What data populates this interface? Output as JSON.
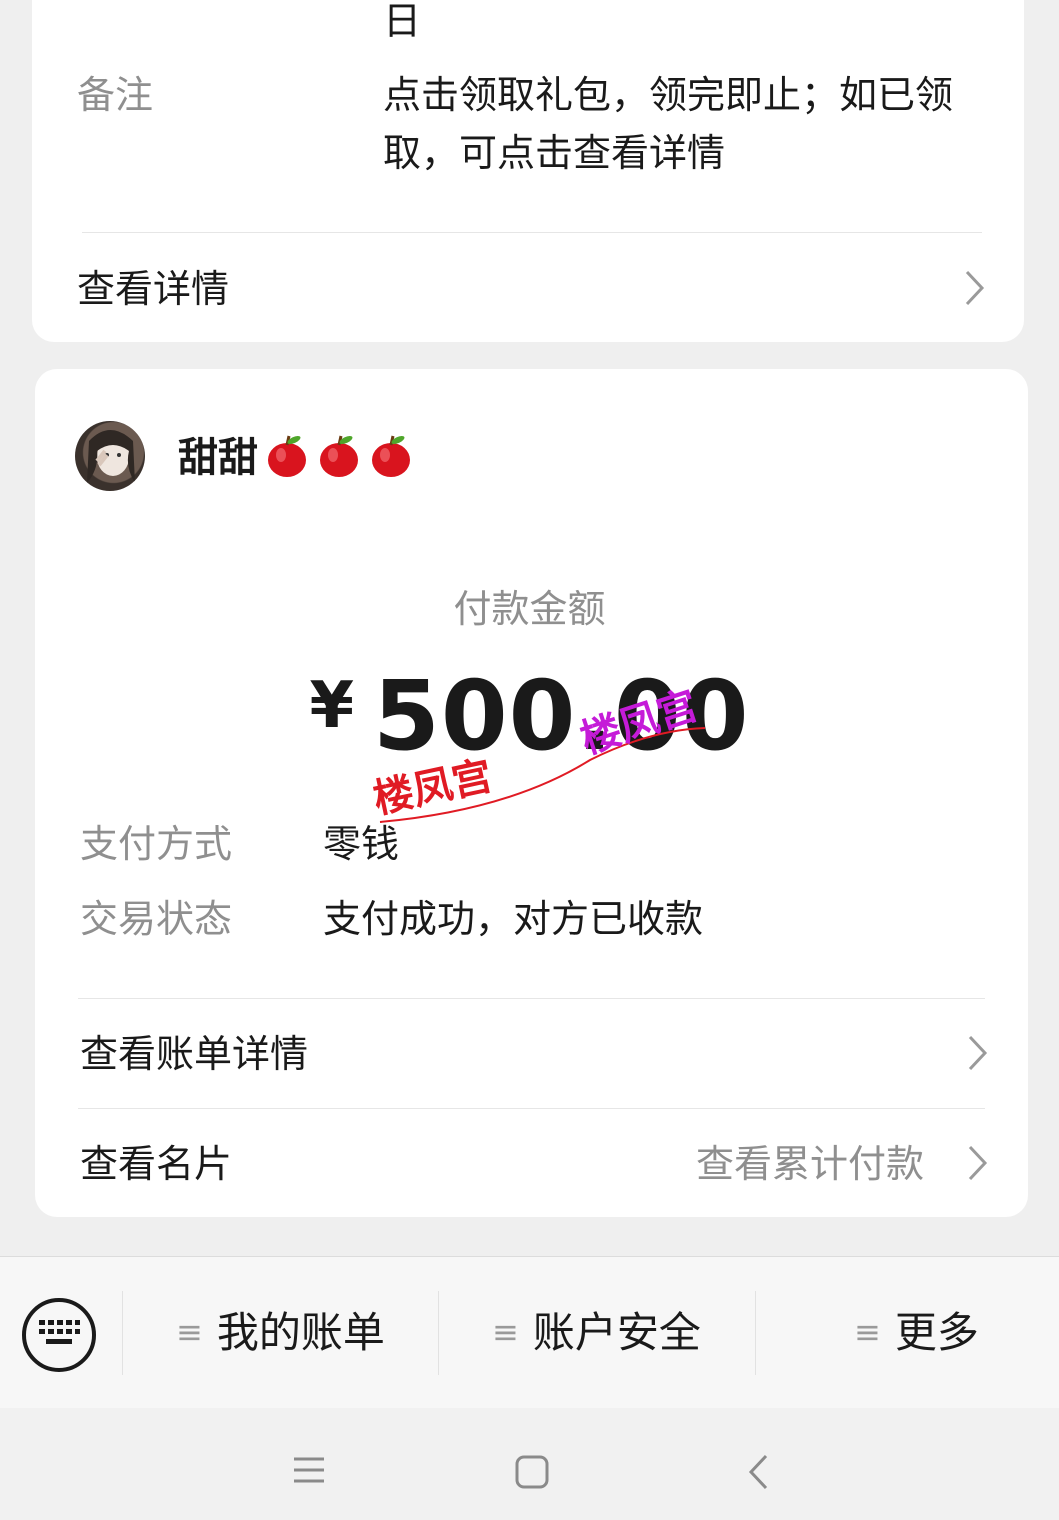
{
  "top_card": {
    "date_tail": "日",
    "remark_label": "备注",
    "remark_line1": "点击领取礼包，领完即止；如已领",
    "remark_line2": "取，可点击查看详情",
    "view_details": "查看详情"
  },
  "payment": {
    "payee_name": "甜甜",
    "payee_emoji_count": 3,
    "amount_label": "付款金额",
    "currency": "¥",
    "amount": "500.00",
    "method_label": "支付方式",
    "method_value": "零钱",
    "status_label": "交易状态",
    "status_value": "支付成功，对方已收款",
    "bill_details": "查看账单详情",
    "view_card": "查看名片",
    "cumulative": "查看累计付款"
  },
  "watermark": {
    "stamp_text": "楼凤宫",
    "stamp_text_2": "楼凤宫"
  },
  "bottom_menu": {
    "items": [
      "我的账单",
      "账户安全",
      "更多"
    ],
    "item_icon": "≡"
  },
  "colors": {
    "background": "#efefef",
    "card": "#ffffff",
    "grey_text": "#8f8f8f",
    "watermark_red": "#e01b24",
    "watermark_purple": "#c51bd8"
  }
}
